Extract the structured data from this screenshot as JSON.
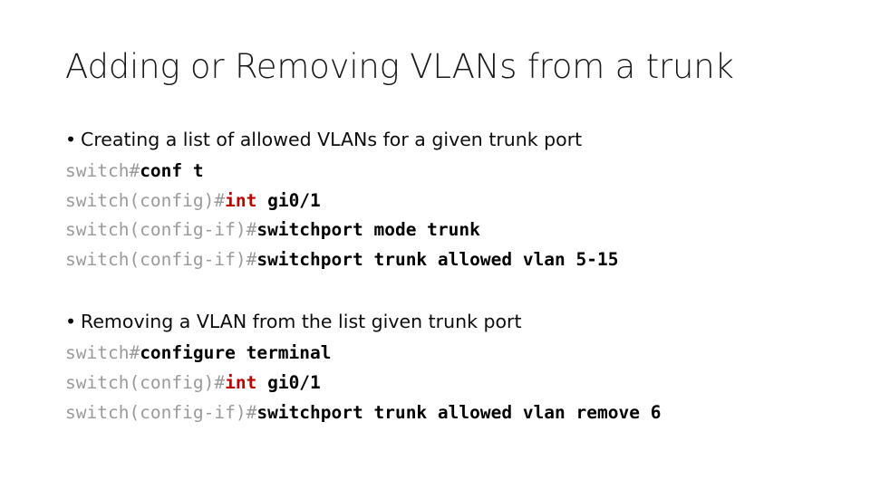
{
  "slide": {
    "title": "Adding or Removing VLANs from a trunk",
    "bullet_glyph": "•",
    "colors": {
      "prompt_gray": "#9a9a9a",
      "command_black": "#000000",
      "keyword_red": "#c00000",
      "text_black": "#0d0d0d",
      "background": "#ffffff"
    },
    "sections": [
      {
        "bullet": "Creating a list of allowed VLANs for a given trunk port",
        "code_lines": [
          {
            "prompt": "switch#",
            "command": "conf t",
            "keyword": ""
          },
          {
            "prompt": "switch(config)#",
            "keyword": "int",
            "command": " gi0/1"
          },
          {
            "prompt": "switch(config-if)#",
            "command": "switchport mode trunk",
            "keyword": ""
          },
          {
            "prompt": "switch(config-if)#",
            "command": "switchport trunk allowed vlan 5-15",
            "keyword": ""
          }
        ]
      },
      {
        "bullet": "Removing a VLAN from the list given trunk port",
        "code_lines": [
          {
            "prompt": "switch#",
            "command": "configure terminal",
            "keyword": ""
          },
          {
            "prompt": "switch(config)#",
            "keyword": "int",
            "command": " gi0/1"
          },
          {
            "prompt": "switch(config-if)#",
            "command": "switchport trunk allowed vlan remove 6",
            "keyword": ""
          }
        ]
      }
    ]
  }
}
